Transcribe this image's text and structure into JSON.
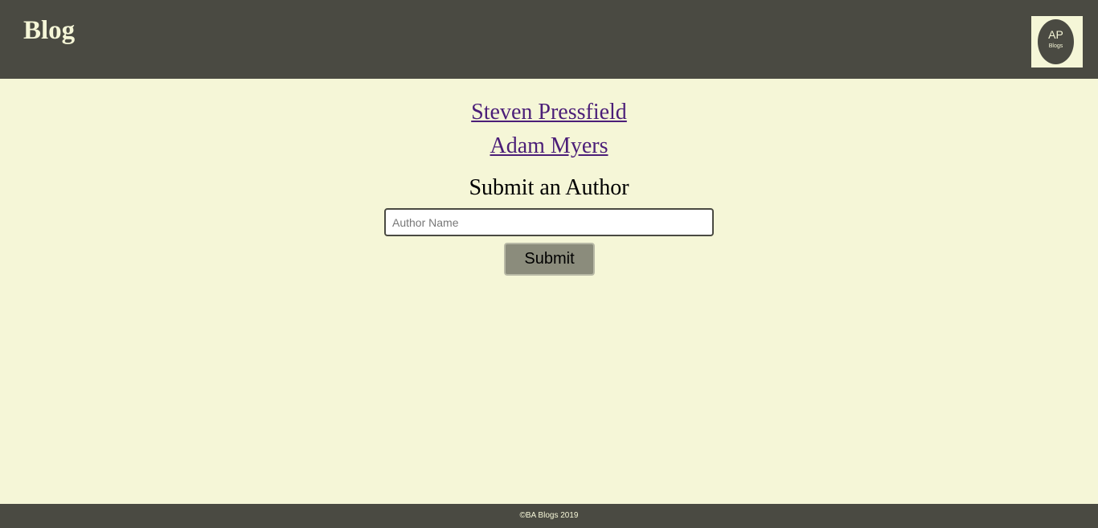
{
  "header": {
    "title": "Blog",
    "logo": {
      "main_text": "AP",
      "sub_text": "Blogs"
    }
  },
  "main": {
    "authors": [
      {
        "label": "Steven Pressfield"
      },
      {
        "label": "Adam Myers"
      }
    ],
    "form": {
      "heading": "Submit an Author",
      "author_input": {
        "value": "",
        "placeholder": "Author Name"
      },
      "submit_label": "Submit"
    }
  },
  "footer": {
    "text": "©BA Blogs 2019"
  },
  "colors": {
    "background": "#f5f6d7",
    "header_bg": "#4a4a42",
    "link": "#4b1e78",
    "button_bg": "#8b8c7c"
  }
}
